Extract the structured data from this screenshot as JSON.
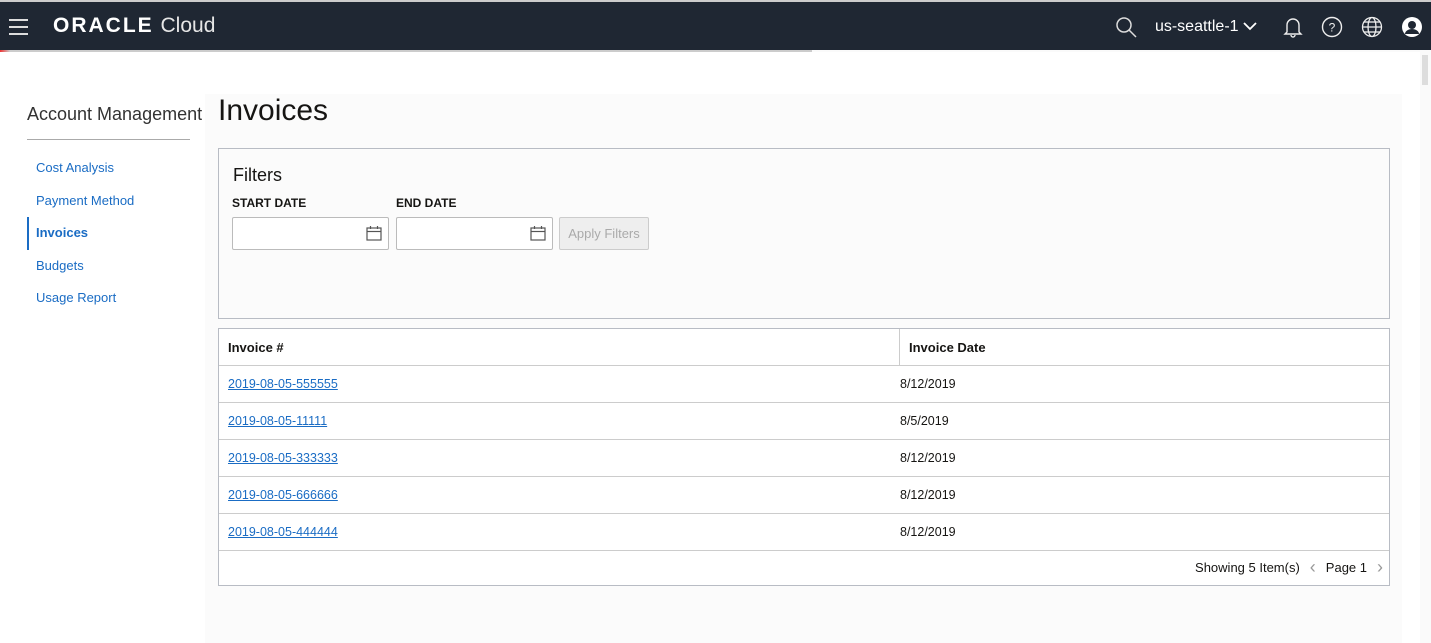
{
  "header": {
    "brand": "ORACLE",
    "product": "Cloud",
    "region": "us-seattle-1"
  },
  "sidebar": {
    "title": "Account Management",
    "items": [
      {
        "label": "Cost Analysis"
      },
      {
        "label": "Payment Method"
      },
      {
        "label": "Invoices",
        "active": true
      },
      {
        "label": "Budgets"
      },
      {
        "label": "Usage Report"
      }
    ]
  },
  "page": {
    "title": "Invoices"
  },
  "filters": {
    "title": "Filters",
    "start_label": "START DATE",
    "end_label": "END DATE",
    "start_value": "",
    "end_value": "",
    "apply_label": "Apply Filters"
  },
  "table": {
    "columns": [
      "Invoice #",
      "Invoice Date"
    ],
    "rows": [
      {
        "invoice": "2019-08-05-555555",
        "date": "8/12/2019"
      },
      {
        "invoice": "2019-08-05-11111",
        "date": "8/5/2019"
      },
      {
        "invoice": "2019-08-05-333333",
        "date": "8/12/2019"
      },
      {
        "invoice": "2019-08-05-666666",
        "date": "8/12/2019"
      },
      {
        "invoice": "2019-08-05-444444",
        "date": "8/12/2019"
      }
    ],
    "footer": {
      "showing": "Showing 5 Item(s)",
      "page": "Page 1"
    }
  },
  "colors": {
    "header_bg": "#1f2733",
    "link": "#1a6cc4"
  }
}
